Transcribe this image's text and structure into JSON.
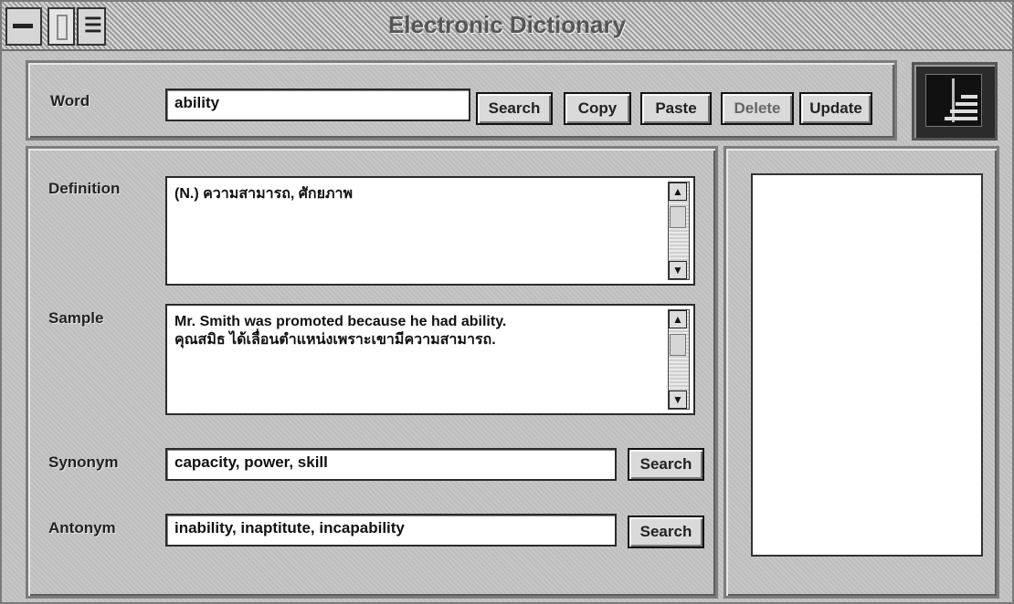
{
  "window": {
    "title": "Electronic Dictionary"
  },
  "word": {
    "label": "Word",
    "value": "ability"
  },
  "toolbar": {
    "search_label": "Search",
    "copy_label": "Copy",
    "paste_label": "Paste",
    "delete_label": "Delete",
    "update_label": "Update"
  },
  "definition": {
    "label": "Definition",
    "text": "(N.) ความสามารถ, ศักยภาพ"
  },
  "sample": {
    "label": "Sample",
    "line1": "Mr. Smith was promoted because he had ability.",
    "line2": "คุณสมิธ ได้เลื่อนตำแหน่งเพราะเขามีความสามารถ."
  },
  "synonym": {
    "label": "Synonym",
    "value": "capacity, power, skill",
    "search_label": "Search"
  },
  "antonym": {
    "label": "Antonym",
    "value": "inability, inaptitute, incapability",
    "search_label": "Search"
  },
  "icons": {
    "system_menu": "system-menu-icon",
    "logo": "dictionary-logo-icon",
    "scroll_up": "arrow-up-icon",
    "scroll_down": "arrow-down-icon"
  }
}
